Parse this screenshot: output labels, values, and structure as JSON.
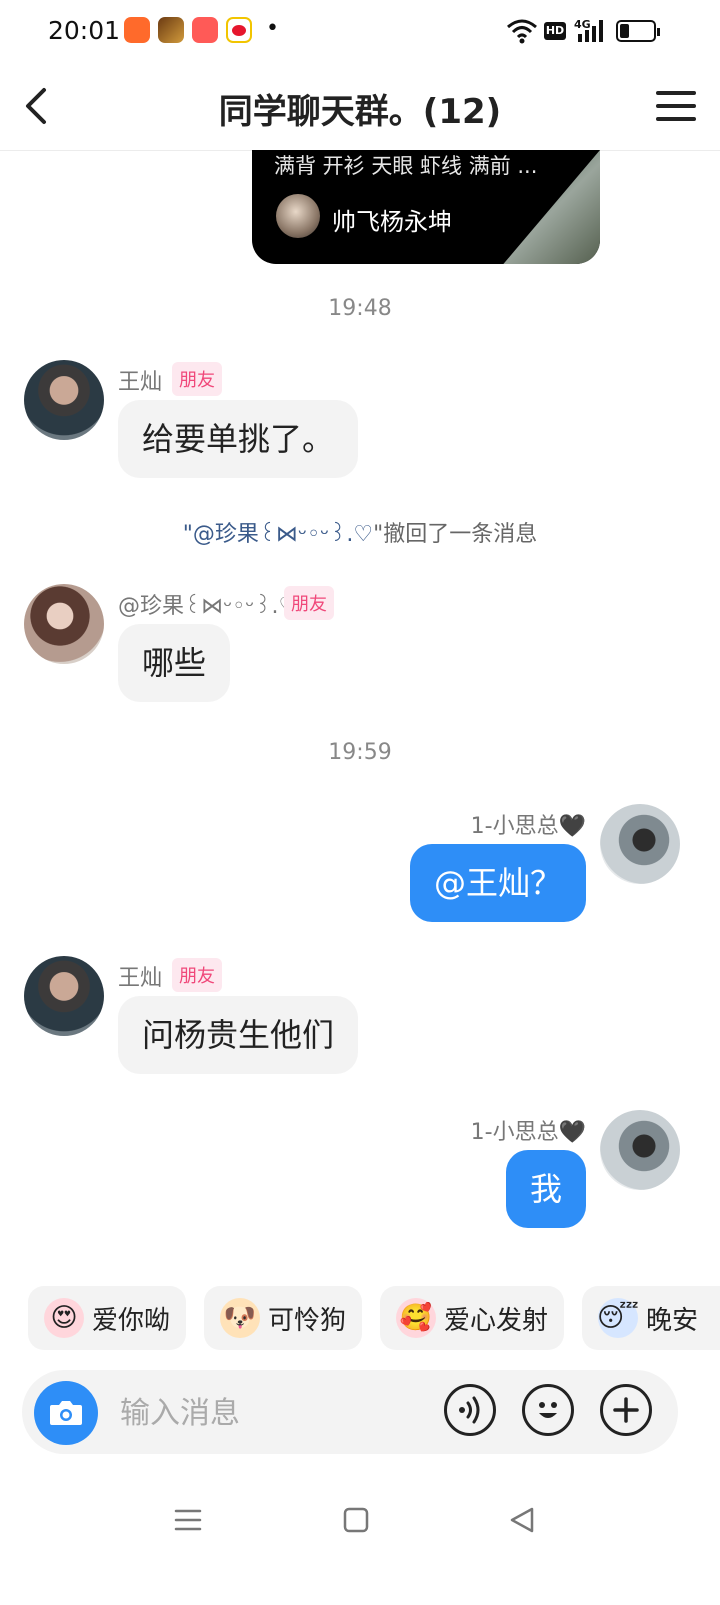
{
  "status_bar": {
    "time": "20:01",
    "app_icons": [
      "xiaohongshu-icon",
      "game-icon",
      "xiaohongshu-icon",
      "weibo-icon"
    ],
    "dot": "•",
    "system_icons": [
      "wifi-icon",
      "hd-icon",
      "signal-4g-icon",
      "battery-icon"
    ],
    "hd_label": "HD",
    "network_label": "4G"
  },
  "header": {
    "title": "同学聊天群。(12)"
  },
  "shared_card": {
    "text": "满背 开衫 天眼 虾线 满前 ...",
    "author": "帅飞杨永坤"
  },
  "messages": [
    {
      "type": "time",
      "text": "19:48"
    },
    {
      "type": "in",
      "sender": "王灿",
      "badge": "朋友",
      "text": "给要单挑了。"
    },
    {
      "type": "notice",
      "who": "\"@珍果꒰⋈ᵕ◦ᵕ꒱.♡",
      "text": "\"撤回了一条消息"
    },
    {
      "type": "in",
      "sender": "@珍果꒰⋈ᵕ◦ᵕ꒱.♡",
      "badge": "朋友",
      "text": "哪些"
    },
    {
      "type": "time",
      "text": "19:59"
    },
    {
      "type": "out",
      "sender": "1-小思总🖤",
      "text": "@王灿？"
    },
    {
      "type": "in",
      "sender": "王灿",
      "badge": "朋友",
      "text": "问杨贵生他们"
    },
    {
      "type": "out",
      "sender": "1-小思总🖤",
      "text": "我"
    }
  ],
  "quick_replies": [
    {
      "emoji": "😍",
      "label": "爱你呦"
    },
    {
      "emoji": "🐶",
      "label": "可怜狗"
    },
    {
      "emoji": "🥰",
      "label": "爱心发射"
    },
    {
      "emoji": "😴",
      "label": "晚安"
    }
  ],
  "input": {
    "placeholder": "输入消息",
    "buttons": [
      "camera-icon",
      "voice-icon",
      "emoji-icon",
      "plus-icon"
    ]
  },
  "nav_bar": [
    "menu-icon",
    "home-icon",
    "back-triangle-icon"
  ]
}
